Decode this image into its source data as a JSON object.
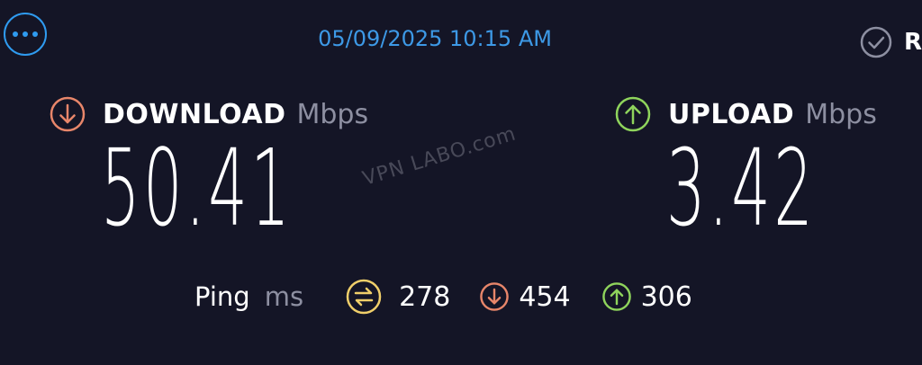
{
  "header": {
    "menu_icon": "more-horizontal-icon",
    "datetime": "05/09/2025 10:15 AM",
    "results_icon": "check-circle-icon",
    "results_label": "R"
  },
  "download": {
    "icon": "arrow-down-circle-icon",
    "title": "DOWNLOAD",
    "unit": "Mbps",
    "value": "50.41",
    "color": "#e8866a"
  },
  "upload": {
    "icon": "arrow-up-circle-icon",
    "title": "UPLOAD",
    "unit": "Mbps",
    "value": "3.42",
    "color": "#8fd45c"
  },
  "watermark": "VPN LABO.com",
  "ping": {
    "label": "Ping",
    "unit": "ms",
    "idle": {
      "icon": "jitter-icon",
      "value": "278",
      "color": "#f0cf6a"
    },
    "download": {
      "icon": "arrow-down-circle-icon",
      "value": "454",
      "color": "#e8866a"
    },
    "upload": {
      "icon": "arrow-up-circle-icon",
      "value": "306",
      "color": "#8fd45c"
    }
  },
  "colors": {
    "background": "#141526",
    "accent": "#2f9bf0",
    "muted": "#8d8fa1"
  }
}
